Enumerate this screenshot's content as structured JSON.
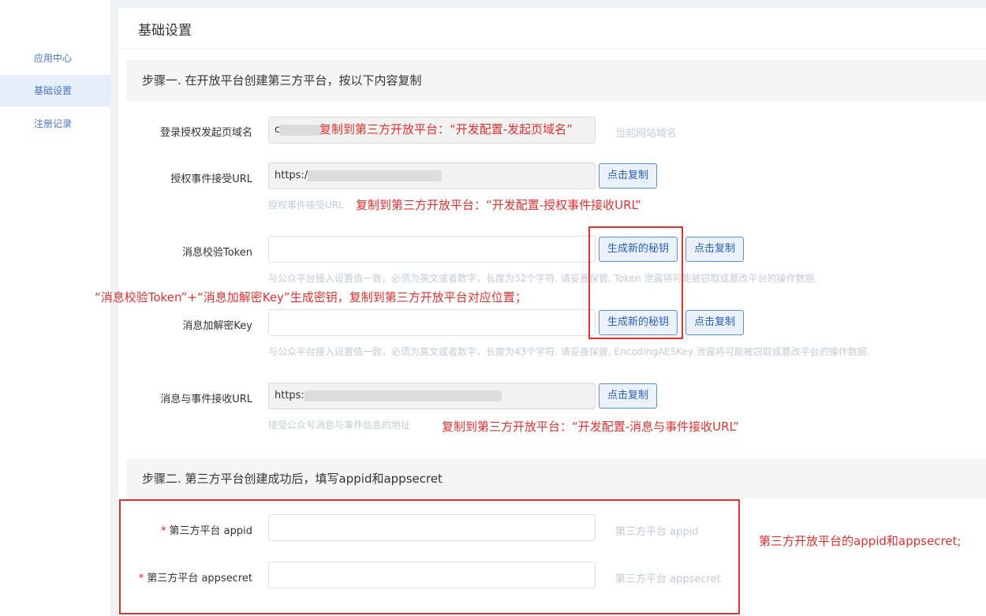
{
  "sidebar": {
    "items": [
      {
        "label": "应用中心"
      },
      {
        "label": "基础设置"
      },
      {
        "label": "注册记录"
      }
    ]
  },
  "panel": {
    "title": "基础设置"
  },
  "step1": {
    "heading": "步骤一. 在开放平台创建第三方平台，按以下内容复制",
    "domain": {
      "label": "登录授权发起页域名",
      "value_prefix": "c",
      "side_hint": "当前网站域名"
    },
    "auth_url": {
      "label": "授权事件接受URL",
      "value_prefix": "https:/",
      "copy_button": "点击复制",
      "hint": "授权事件接受URL"
    },
    "token": {
      "label": "消息校验Token",
      "value": "",
      "generate_button": "生成新的秘钥",
      "copy_button": "点击复制",
      "hint": "与公众平台接入设置值一致，必须为英文或者数字，长度为32个字符. 请妥善保管, Token 泄露将可能被窃取或篡改平台的操作数据."
    },
    "aes_key": {
      "label": "消息加解密Key",
      "value": "",
      "generate_button": "生成新的秘钥",
      "copy_button": "点击复制",
      "hint": "与公众平台接入设置值一致，必须为英文或者数字，长度为43个字符. 请妥善保管, EncodingAESKey 泄露将可能被窃取或篡改平台的操作数据."
    },
    "msg_url": {
      "label": "消息与事件接收URL",
      "value_prefix": "https:",
      "copy_button": "点击复制",
      "hint": "接受公众号消息与事件信息的地址"
    }
  },
  "step2": {
    "heading": "步骤二. 第三方平台创建成功后，填写appid和appsecret",
    "required_mark": "*",
    "appid": {
      "label": "第三方平台 appid",
      "value": "",
      "side_hint": "第三方平台 appid"
    },
    "appsecret": {
      "label": "第三方平台 appsecret",
      "value": "",
      "side_hint": "第三方平台 appsecret"
    }
  },
  "annotations": {
    "domain": "复制到第三方开放平台：“开发配置-发起页域名”",
    "auth_url": "复制到第三方开放平台：“开发配置-授权事件接收URL”",
    "keys": "“消息校验Token”+“消息加解密Key”生成密钥，复制到第三方开放平台对应位置；",
    "msg_url": "复制到第三方开放平台：“开发配置-消息与事件接收URL”",
    "appid": "第三方开放平台的appid和appsecret;",
    "color": "#e53030"
  }
}
